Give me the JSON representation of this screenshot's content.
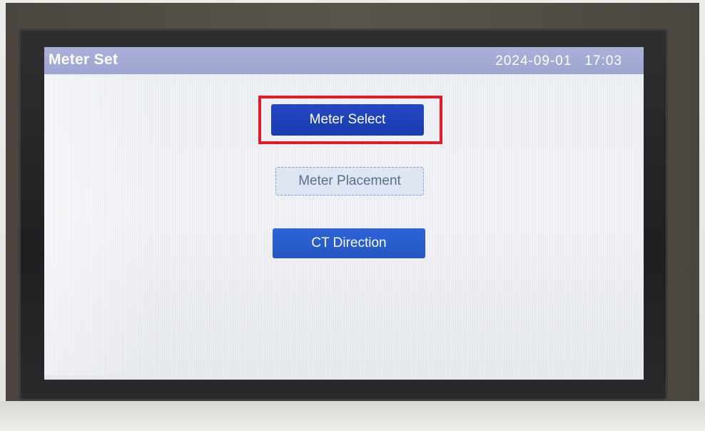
{
  "header": {
    "title": "Meter Set",
    "date": "2024-09-01",
    "time": "17:03"
  },
  "menu": {
    "items": [
      {
        "label": "Meter Select",
        "state": "selected"
      },
      {
        "label": "Meter Placement",
        "state": "focused"
      },
      {
        "label": "CT Direction",
        "state": "normal"
      }
    ]
  },
  "colors": {
    "titlebar": "#9ea5d0",
    "button_primary": "#1b3cae",
    "button_secondary": "#2456c4",
    "highlight": "#e21b2a"
  }
}
